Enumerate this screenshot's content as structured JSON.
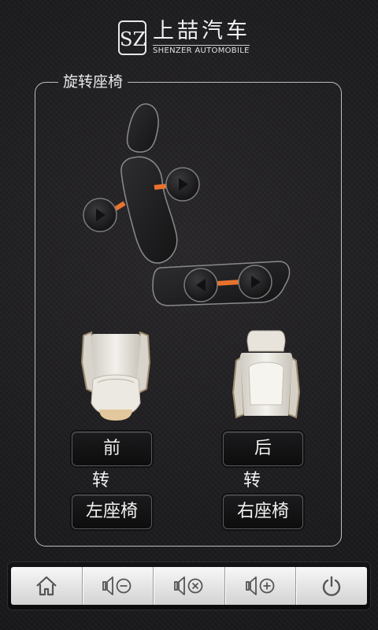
{
  "brand": {
    "logo_mark": "SZ",
    "name_cn": "上喆汽车",
    "name_en": "SHENZER AUTOMOBILE"
  },
  "panel": {
    "title": "旋转座椅"
  },
  "controls": {
    "front_rotate": "前转",
    "rear_rotate": "后转",
    "left_seat": "左座椅",
    "right_seat": "右座椅"
  },
  "toolbar": {
    "items": [
      {
        "icon": "home-icon"
      },
      {
        "icon": "volume-down-icon"
      },
      {
        "icon": "mute-icon"
      },
      {
        "icon": "volume-up-icon"
      },
      {
        "icon": "power-icon"
      }
    ]
  },
  "colors": {
    "accent": "#e8732e",
    "panel_border": "#bdbdbd",
    "background": "#1e1d20"
  }
}
